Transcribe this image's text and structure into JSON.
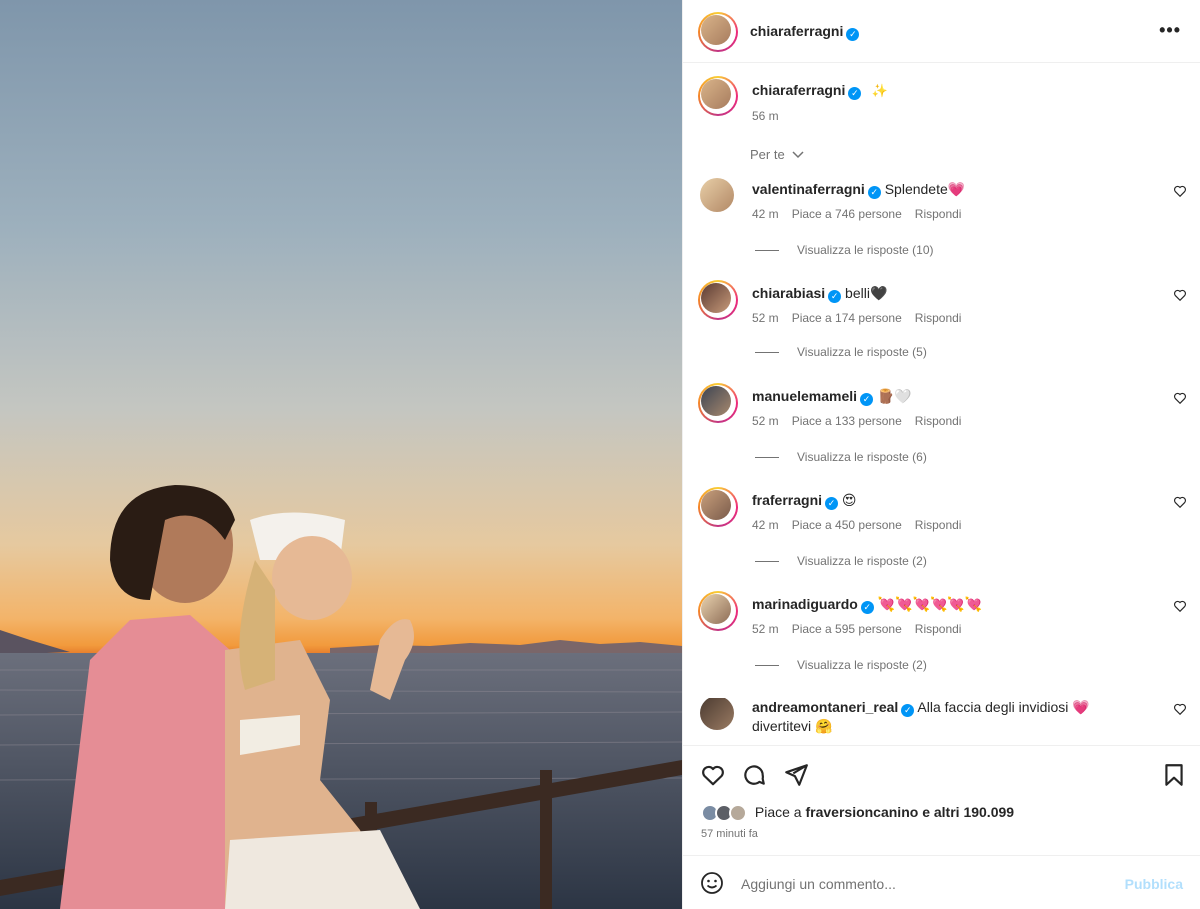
{
  "post": {
    "author": "chiaraferragni",
    "caption_emoji": "✨",
    "caption_time": "56 m",
    "sort_label": "Per te",
    "likes_prefix": "Piace a",
    "likes_user": "fraversioncanino",
    "likes_suffix": "e altri 190.099",
    "posted_time": "57 minuti fa"
  },
  "comments": [
    {
      "user": "valentinaferragni",
      "text": "Splendete💗",
      "time": "42 m",
      "likes": "Piace a 746 persone",
      "reply": "Rispondi",
      "replies": "Visualizza le risposte (10)"
    },
    {
      "user": "chiarabiasi",
      "text": "belli🖤",
      "time": "52 m",
      "likes": "Piace a 174 persone",
      "reply": "Rispondi",
      "replies": "Visualizza le risposte (5)"
    },
    {
      "user": "manuelemameli",
      "text": "🪵🤍",
      "time": "52 m",
      "likes": "Piace a 133 persone",
      "reply": "Rispondi",
      "replies": "Visualizza le risposte (6)"
    },
    {
      "user": "fraferragni",
      "text": "😍",
      "time": "42 m",
      "likes": "Piace a 450 persone",
      "reply": "Rispondi",
      "replies": "Visualizza le risposte (2)"
    },
    {
      "user": "marinadiguardo",
      "text": "💘💘💘💘💘💘",
      "time": "52 m",
      "likes": "Piace a 595 persone",
      "reply": "Rispondi",
      "replies": "Visualizza le risposte (2)"
    },
    {
      "user": "andreamontaneri_real",
      "text": "Alla faccia degli invidiosi 💗 divertitevi 🤗"
    }
  ],
  "composer": {
    "placeholder": "Aggiungi un commento...",
    "publish": "Pubblica"
  },
  "colors": {
    "accent": "#0095f6",
    "muted": "#737373",
    "publish_disabled": "#b2dffc"
  }
}
